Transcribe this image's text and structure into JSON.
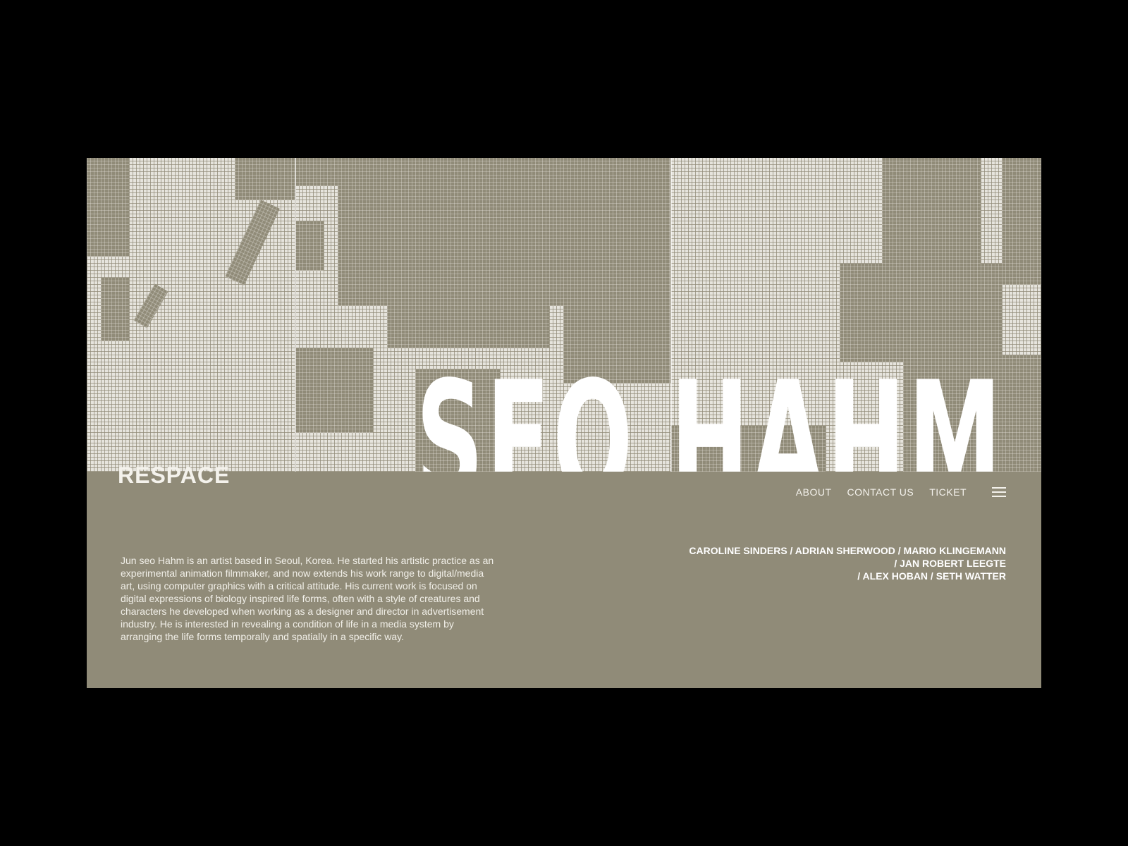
{
  "hero": {
    "title": "JUN SEO HAHM"
  },
  "brand": {
    "logo": "RESPACE"
  },
  "nav": {
    "items": [
      {
        "label": "ABOUT"
      },
      {
        "label": "CONTACT US"
      },
      {
        "label": "TICKET"
      }
    ],
    "menu_icon": "hamburger-menu-icon"
  },
  "bio": {
    "text": "Jun seo Hahm is an artist based in Seoul, Korea. He started his artistic practice as an experimental animation filmmaker, and now extends his work range to digital/media art, using computer graphics with a critical attitude. His current work is focused on digital expressions of biology inspired life forms, often with a style of creatures and characters he developed when working as a designer and director in advertisement industry. He is interested in revealing a condition of life in a media system by arranging the life forms temporally and spatially in a specific way."
  },
  "artists": {
    "lines": [
      "CAROLINE SINDERS / ADRIAN SHERWOOD / MARIO KLINGEMANN",
      "/ JAN ROBERT LEEGTE",
      "/ ALEX HOBAN / SETH WATTER"
    ]
  },
  "colors": {
    "background": "#000000",
    "panel": "#908b78",
    "halftone_light": "#e9e7e1",
    "text": "#ffffff"
  }
}
